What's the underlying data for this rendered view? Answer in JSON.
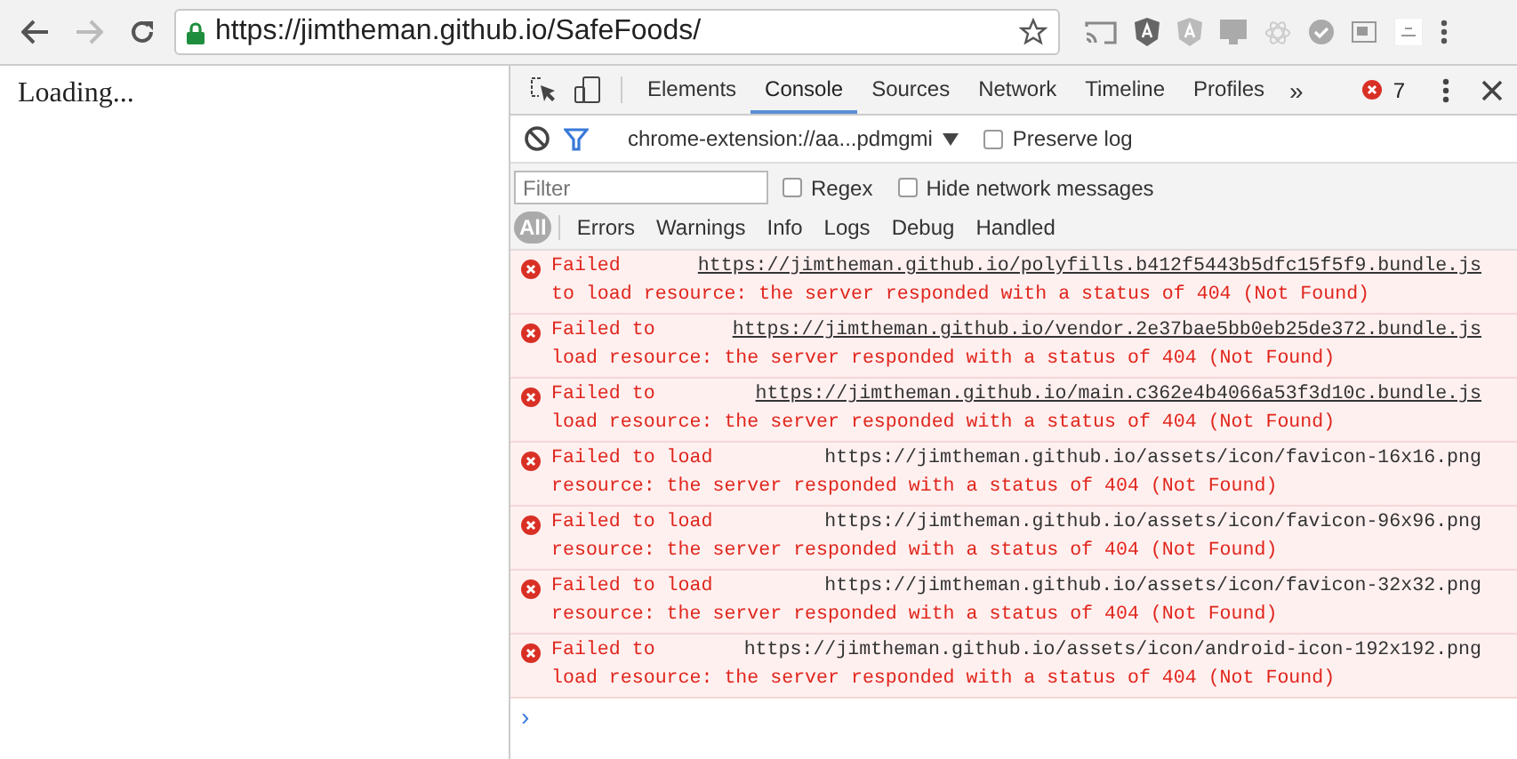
{
  "browser": {
    "url": "https://jimtheman.github.io/SafeFoods/",
    "bookmarked": false
  },
  "page": {
    "text": "Loading..."
  },
  "devtools": {
    "tabs": [
      {
        "label": "Elements",
        "selected": false
      },
      {
        "label": "Console",
        "selected": true
      },
      {
        "label": "Sources",
        "selected": false
      },
      {
        "label": "Network",
        "selected": false
      },
      {
        "label": "Timeline",
        "selected": false
      },
      {
        "label": "Profiles",
        "selected": false
      }
    ],
    "more_tabs": "»",
    "error_count": "7",
    "context": "chrome-extension://aa...pdmgmi",
    "preserve_log": {
      "label": "Preserve log",
      "checked": false
    },
    "filter": {
      "placeholder": "Filter"
    },
    "regex": {
      "label": "Regex",
      "checked": false
    },
    "hide_network": {
      "label": "Hide network messages",
      "checked": false
    },
    "levels": [
      {
        "label": "All",
        "selected": true
      },
      {
        "label": "Errors",
        "selected": false
      },
      {
        "label": "Warnings",
        "selected": false
      },
      {
        "label": "Info",
        "selected": false
      },
      {
        "label": "Logs",
        "selected": false
      },
      {
        "label": "Debug",
        "selected": false
      },
      {
        "label": "Handled",
        "selected": false
      }
    ],
    "messages": [
      {
        "head": "Failed",
        "url": "https://jimtheman.github.io/polyfills.b412f5443b5dfc15f5f9.bundle.js",
        "linked": true,
        "tail": "to load resource: the server responded with a status of 404 (Not Found)"
      },
      {
        "head": "Failed to",
        "url": "https://jimtheman.github.io/vendor.2e37bae5bb0eb25de372.bundle.js",
        "linked": true,
        "tail": "load resource: the server responded with a status of 404 (Not Found)"
      },
      {
        "head": "Failed to",
        "url": "https://jimtheman.github.io/main.c362e4b4066a53f3d10c.bundle.js",
        "linked": true,
        "tail": "load resource: the server responded with a status of 404 (Not Found)"
      },
      {
        "head": "Failed to load",
        "url": "https://jimtheman.github.io/assets/icon/favicon-16x16.png",
        "linked": false,
        "tail": "resource: the server responded with a status of 404 (Not Found)"
      },
      {
        "head": "Failed to load",
        "url": "https://jimtheman.github.io/assets/icon/favicon-96x96.png",
        "linked": false,
        "tail": "resource: the server responded with a status of 404 (Not Found)"
      },
      {
        "head": "Failed to load",
        "url": "https://jimtheman.github.io/assets/icon/favicon-32x32.png",
        "linked": false,
        "tail": "resource: the server responded with a status of 404 (Not Found)"
      },
      {
        "head": "Failed to",
        "url": "https://jimtheman.github.io/assets/icon/android-icon-192x192.png",
        "linked": false,
        "tail": "load resource: the server responded with a status of 404 (Not Found)"
      }
    ],
    "prompt": "›"
  }
}
